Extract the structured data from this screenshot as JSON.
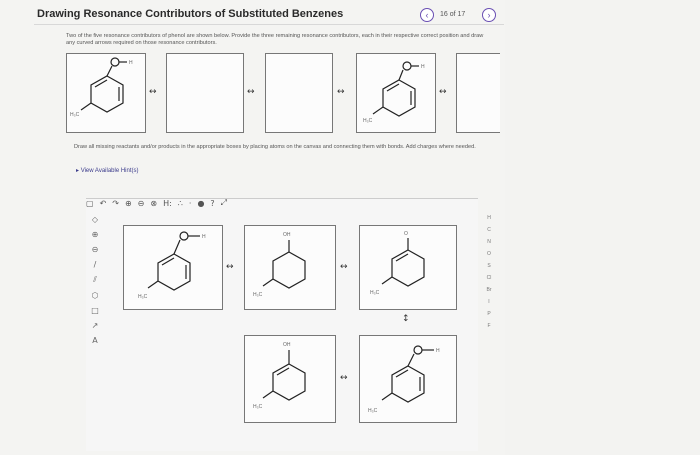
{
  "header": {
    "title": "Drawing Resonance Contributors of Substituted Benzenes",
    "page_count": "16 of 17"
  },
  "icons": {
    "prev": "chevron-left-icon",
    "next": "chevron-right-icon"
  },
  "instructions": {
    "intro": "Two of the five resonance contributors of phenol are shown below. Provide the three remaining resonance contributors, each in their respective correct position and draw any curved arrows required on those resonance contributors.",
    "task": "Draw all missing reactants and/or products in the appropriate boxes by placing atoms on the canvas and connecting them with bonds. Add charges where needed.",
    "hints": "View Available Hint(s)"
  },
  "toolbar": {
    "h_button": "H:"
  },
  "labels": {
    "oh": "OH",
    "h": "H",
    "h3c": "H₃C",
    "o": "O"
  },
  "right_tools": [
    "H",
    "C",
    "N",
    "O",
    "S",
    "Cl",
    "Br",
    "I",
    "P",
    "F"
  ],
  "colors": {
    "accent": "#6a4fb3",
    "box_border": "#777777"
  }
}
